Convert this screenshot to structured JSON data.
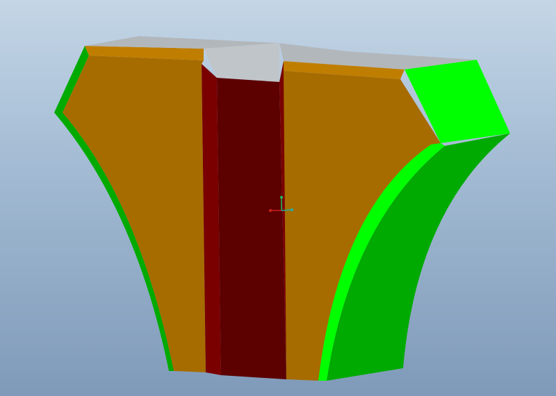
{
  "scene": {
    "model": "cad-part-with-slot",
    "colors": {
      "background_top": "#c4d6e6",
      "background_bottom": "#7f9ab9",
      "front_face": "#a66c00",
      "top_edge_band": "#c07e00",
      "top_face": "#b2b7bb",
      "top_face_light": "#c0c5c9",
      "slot_front": "#5c0000",
      "slot_side": "#7a0000",
      "side_face_bright": "#00ff00",
      "side_face_dark": "#00aa00",
      "side_face_mid": "#00e000",
      "axis_x": "#d02020",
      "axis_y": "#20c060",
      "axis_z": "#20b0a0"
    },
    "icons": {
      "triad": "coordinate-axis-triad-icon"
    }
  }
}
